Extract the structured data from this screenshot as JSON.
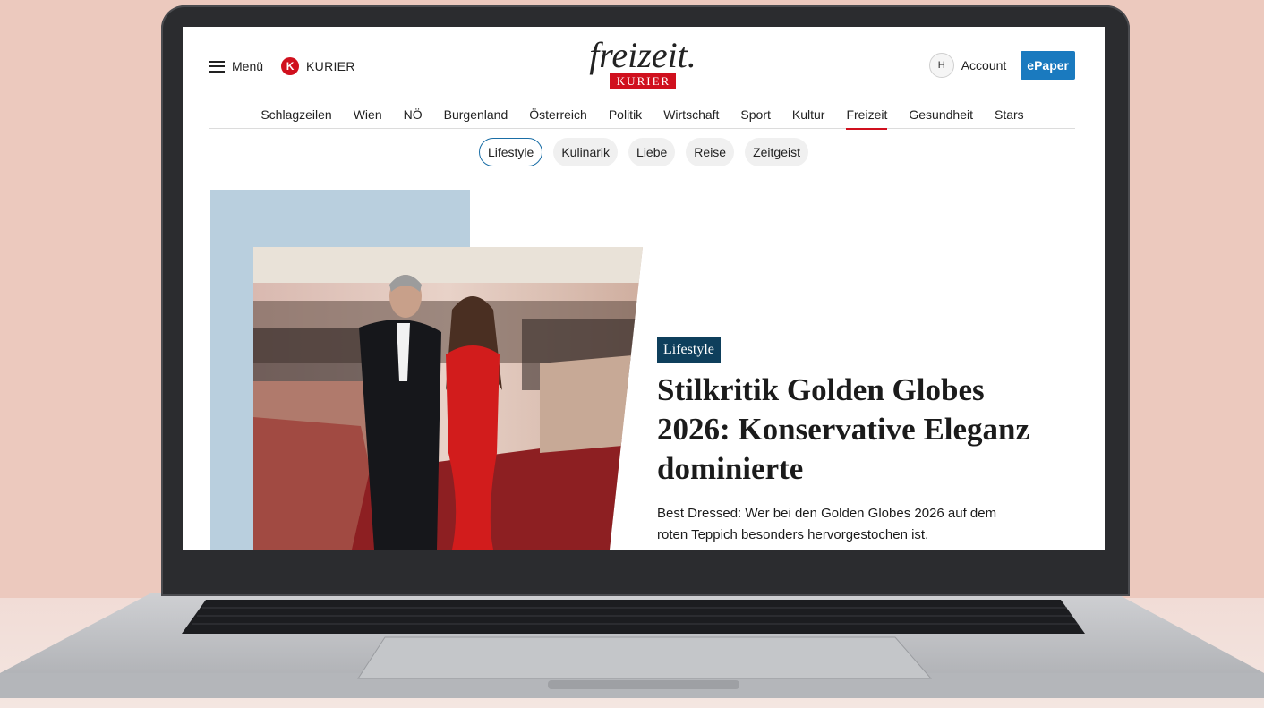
{
  "header": {
    "menu_label": "Menü",
    "kurier_badge": "K",
    "kurier_label": "KURIER",
    "logo_word": "freizeit.",
    "logo_sub": "KURIER",
    "avatar_initial": "H",
    "account_label": "Account",
    "epaper_label": "ePaper"
  },
  "nav": {
    "items": [
      {
        "label": "Schlagzeilen"
      },
      {
        "label": "Wien"
      },
      {
        "label": "NÖ"
      },
      {
        "label": "Burgenland"
      },
      {
        "label": "Österreich"
      },
      {
        "label": "Politik"
      },
      {
        "label": "Wirtschaft"
      },
      {
        "label": "Sport"
      },
      {
        "label": "Kultur"
      },
      {
        "label": "Freizeit",
        "active": true
      },
      {
        "label": "Gesundheit"
      },
      {
        "label": "Stars"
      }
    ]
  },
  "subnav": {
    "items": [
      {
        "label": "Lifestyle",
        "active": true
      },
      {
        "label": "Kulinarik"
      },
      {
        "label": "Liebe"
      },
      {
        "label": "Reise"
      },
      {
        "label": "Zeitgeist"
      }
    ]
  },
  "hero": {
    "tag": "Lifestyle",
    "headline": "Stilkritik Golden Globes 2026: Konservative Eleganz dominierte",
    "teaser": "Best Dressed: Wer bei den Golden Globes 2026 auf dem roten Teppich besonders hervorgestochen ist."
  },
  "colors": {
    "brand_red": "#d0101e",
    "epaper_blue": "#1a7abf",
    "tag_navy": "#0e3f5c",
    "hero_bg": "#b9cfde",
    "page_bg": "#ecc9be"
  }
}
